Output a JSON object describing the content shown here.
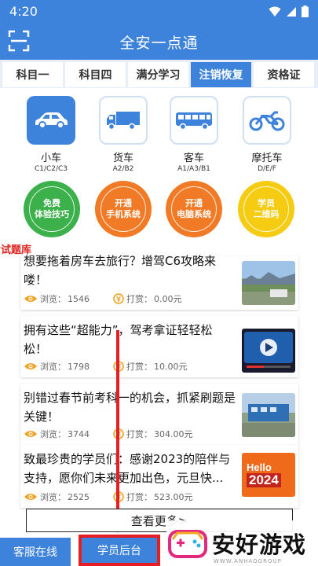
{
  "status": {
    "time": "4:20"
  },
  "app": {
    "title": "全安一点通"
  },
  "tabs": [
    {
      "label": "科目一"
    },
    {
      "label": "科目四"
    },
    {
      "label": "满分学习"
    },
    {
      "label": "注销恢复",
      "active": true
    },
    {
      "label": "资格证"
    }
  ],
  "vehicles": [
    {
      "name": "小车",
      "sub": "C1/C2/C3",
      "icon": "car-icon",
      "active": true
    },
    {
      "name": "货车",
      "sub": "A2/B2",
      "icon": "truck-icon"
    },
    {
      "name": "客车",
      "sub": "A1/A3/B1",
      "icon": "bus-icon"
    },
    {
      "name": "摩托车",
      "sub": "D/E/F",
      "icon": "motorcycle-icon"
    }
  ],
  "features": [
    {
      "line1": "免费",
      "line2": "体验技巧",
      "color": "#3cb04a"
    },
    {
      "line1": "开通",
      "line2": "手机系统",
      "color": "#f07a25"
    },
    {
      "line1": "开通",
      "line2": "电脑系统",
      "color": "#f07a25"
    },
    {
      "line1": "学员",
      "line2": "二维码",
      "color": "#f5cc12"
    }
  ],
  "section_label": "考试题库",
  "articles": [
    {
      "title": "想要拖着房车去旅行？增驾C6攻略来喽！",
      "views_label": "浏览：",
      "views": "1546",
      "reward_label": "打赏：",
      "reward": "0.00元",
      "thumb": "landscape"
    },
    {
      "title": "拥有这些“超能力”，驾考拿证轻轻松松！",
      "views_label": "浏览：",
      "views": "1798",
      "reward_label": "打赏：",
      "reward": "10.00元",
      "thumb": "video"
    },
    {
      "title": "别错过春节前考科一的机会，抓紧刷题是关键！",
      "views_label": "浏览：",
      "views": "3744",
      "reward_label": "打赏：",
      "reward": "304.00元",
      "thumb": "building"
    },
    {
      "title": "致最珍贵的学员们：感谢2023的陪伴与支持，愿你们未来更加出色，元旦快...",
      "views_label": "浏览：",
      "views": "2525",
      "reward_label": "打赏：",
      "reward": "523.00元",
      "thumb": "hello2024",
      "thumb_text1": "Hello",
      "thumb_text2": "2024"
    }
  ],
  "see_more": "查看更多>",
  "bottom": {
    "kefu": "客服在线",
    "xueyuan": "学员后台"
  },
  "watermark": {
    "text": "安好游戏",
    "sub": "WWW.ANHAOGROUP"
  },
  "colors": {
    "primary": "#3d82db",
    "highlight": "#e51e24",
    "section_red": "#e0201c"
  }
}
